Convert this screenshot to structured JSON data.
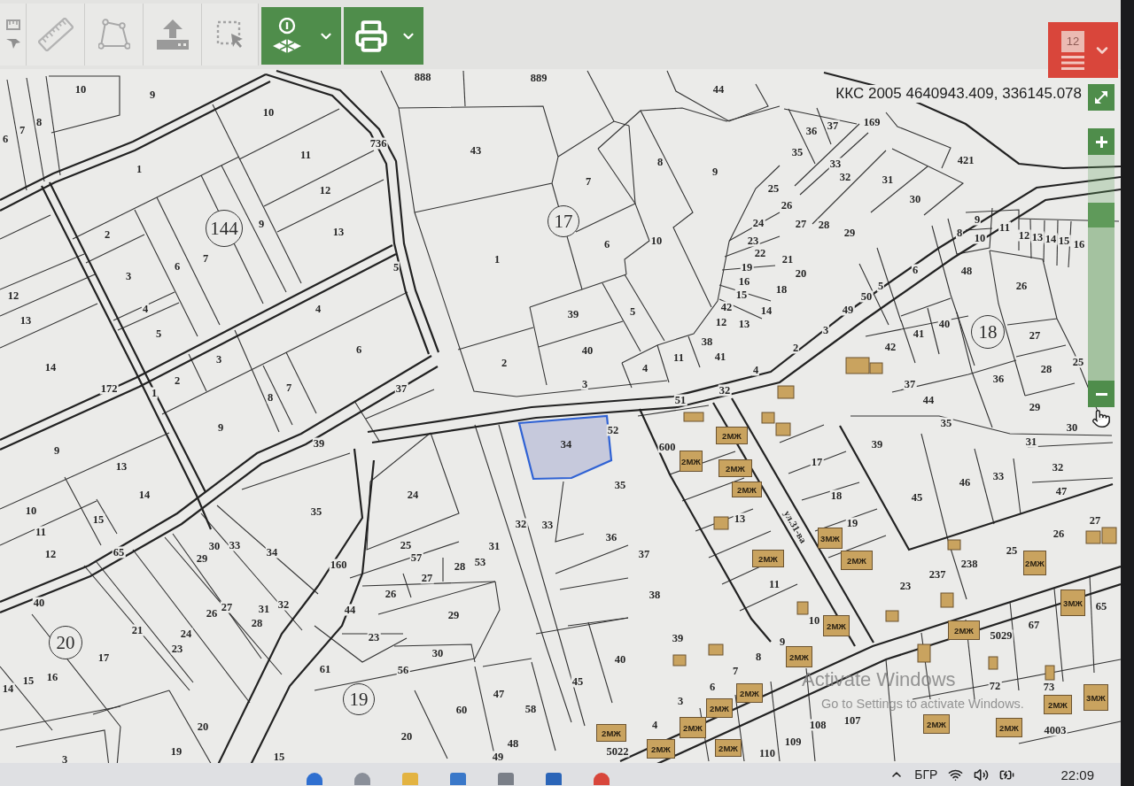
{
  "toolbar": {
    "menu_badge": "12"
  },
  "map": {
    "coordinates": "ККС 2005 4640943.409, 336145.078",
    "parcel_numbers": [
      "888",
      "889",
      "10",
      "9",
      "44",
      "10",
      "7",
      "8",
      "37",
      "169",
      "6",
      "36",
      "11",
      "736",
      "43",
      "35",
      "421",
      "1",
      "8",
      "33",
      "12",
      "7",
      "9",
      "25",
      "32",
      "31",
      "26",
      "30",
      "9",
      "24",
      "27",
      "28",
      "9",
      "11",
      "2",
      "13",
      "29",
      "8",
      "10",
      "12",
      "13",
      "14",
      "6",
      "10",
      "23",
      "15",
      "16",
      "7",
      "1",
      "22",
      "21",
      "6",
      "5",
      "19",
      "20",
      "6",
      "48",
      "3",
      "16",
      "18",
      "5",
      "26",
      "12",
      "15",
      "50",
      "4",
      "4",
      "39",
      "5",
      "42",
      "14",
      "49",
      "13",
      "12",
      "13",
      "40",
      "5",
      "3",
      "41",
      "27",
      "6",
      "40",
      "11",
      "38",
      "41",
      "2",
      "42",
      "14",
      "3",
      "2",
      "25",
      "4",
      "4",
      "28",
      "2",
      "3",
      "37",
      "36",
      "172",
      "1",
      "7",
      "37",
      "32",
      "8",
      "51",
      "44",
      "29",
      "9",
      "52",
      "35",
      "30",
      "39",
      "600",
      "39",
      "31",
      "9",
      "13",
      "17",
      "32",
      "46",
      "33",
      "14",
      "24",
      "35",
      "18",
      "45",
      "47",
      "10",
      "15",
      "35",
      "32",
      "33",
      "13",
      "19",
      "27",
      "11",
      "36",
      "26",
      "12",
      "65",
      "29",
      "30",
      "33",
      "34",
      "25",
      "57",
      "53",
      "31",
      "37",
      "25",
      "160",
      "28",
      "238",
      "27",
      "237",
      "11",
      "23",
      "26",
      "38",
      "40",
      "27",
      "31",
      "32",
      "44",
      "65",
      "26",
      "29",
      "10",
      "21",
      "28",
      "67",
      "24",
      "23",
      "39",
      "9",
      "5029",
      "17",
      "23",
      "30",
      "40",
      "8",
      "16",
      "61",
      "56",
      "7",
      "14",
      "15",
      "45",
      "6",
      "72",
      "73",
      "47",
      "3",
      "60",
      "58",
      "20",
      "4",
      "108",
      "107",
      "20",
      "4003",
      "48",
      "109",
      "3",
      "19",
      "15",
      "49",
      "5022",
      "110"
    ],
    "block_numbers": [
      "144",
      "17",
      "18",
      "20",
      "19"
    ],
    "selected_parcel": {
      "label": "34"
    },
    "street_name": "ул.31-ва",
    "buildings": [
      {
        "label": "2МЖ"
      },
      {
        "label": "2МЖ"
      },
      {
        "label": "2МЖ"
      },
      {
        "label": "2МЖ"
      },
      {
        "label": "3МЖ"
      },
      {
        "label": "2МЖ"
      },
      {
        "label": "2МЖ"
      },
      {
        "label": "2МЖ"
      },
      {
        "label": "3МЖ"
      },
      {
        "label": "2МЖ"
      },
      {
        "label": "2МЖ"
      },
      {
        "label": "2МЖ"
      },
      {
        "label": "2МЖ"
      },
      {
        "label": "2МЖ"
      },
      {
        "label": "2МЖ"
      },
      {
        "label": "3МЖ"
      },
      {
        "label": "2МЖ"
      },
      {
        "label": "2МЖ"
      },
      {
        "label": "2МЖ"
      },
      {
        "label": "2МЖ"
      },
      {
        "label": "2МЖ"
      },
      {
        "label": "2МЖ"
      }
    ],
    "zoom": {
      "level": 0.76
    },
    "activation_notice": {
      "title": "Activate Windows",
      "text": "Go to Settings to activate Windows."
    }
  },
  "taskbar": {
    "language": "БГР",
    "time": "22:09"
  }
}
